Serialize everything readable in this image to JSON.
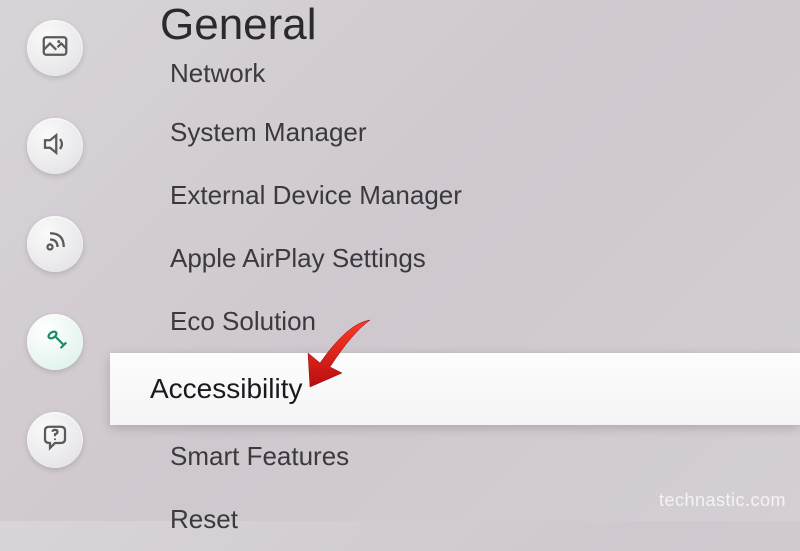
{
  "page": {
    "title": "General"
  },
  "sidebar": {
    "icons": [
      {
        "name": "picture-icon"
      },
      {
        "name": "sound-icon"
      },
      {
        "name": "broadcasting-icon"
      },
      {
        "name": "general-icon",
        "active": true
      },
      {
        "name": "support-icon"
      }
    ]
  },
  "menu": {
    "items": [
      {
        "label": "Network",
        "partial": true
      },
      {
        "label": "System Manager"
      },
      {
        "label": "External Device Manager"
      },
      {
        "label": "Apple AirPlay Settings"
      },
      {
        "label": "Eco Solution"
      },
      {
        "label": "Accessibility",
        "selected": true
      },
      {
        "label": "Smart Features"
      },
      {
        "label": "Reset"
      }
    ]
  },
  "annotation": {
    "arrow_color": "#d81e1e"
  },
  "watermark": "technastic.com"
}
